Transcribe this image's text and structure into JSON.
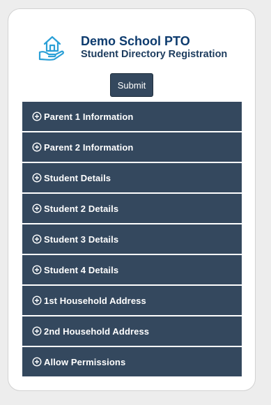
{
  "header": {
    "logo_icon": "house-in-hand-icon",
    "title": "Demo School PTO",
    "subtitle": "Student Directory Registration"
  },
  "form": {
    "submit_label": "Submit"
  },
  "sections": [
    {
      "label": "Parent 1 Information",
      "icon": "plus-circle-icon"
    },
    {
      "label": "Parent 2 Information",
      "icon": "plus-circle-icon"
    },
    {
      "label": "Student Details",
      "icon": "plus-circle-icon"
    },
    {
      "label": "Student 2 Details",
      "icon": "plus-circle-icon"
    },
    {
      "label": "Student 3 Details",
      "icon": "plus-circle-icon"
    },
    {
      "label": "Student 4 Details",
      "icon": "plus-circle-icon"
    },
    {
      "label": "1st Household Address",
      "icon": "plus-circle-icon"
    },
    {
      "label": "2nd Household Address",
      "icon": "plus-circle-icon"
    },
    {
      "label": "Allow Permissions",
      "icon": "plus-circle-icon"
    }
  ],
  "colors": {
    "page_background": "#ededed",
    "card_background": "#ffffff",
    "section_background": "#34485e",
    "title_color": "#0d3b6e",
    "logo_color": "#2a9fd6"
  }
}
